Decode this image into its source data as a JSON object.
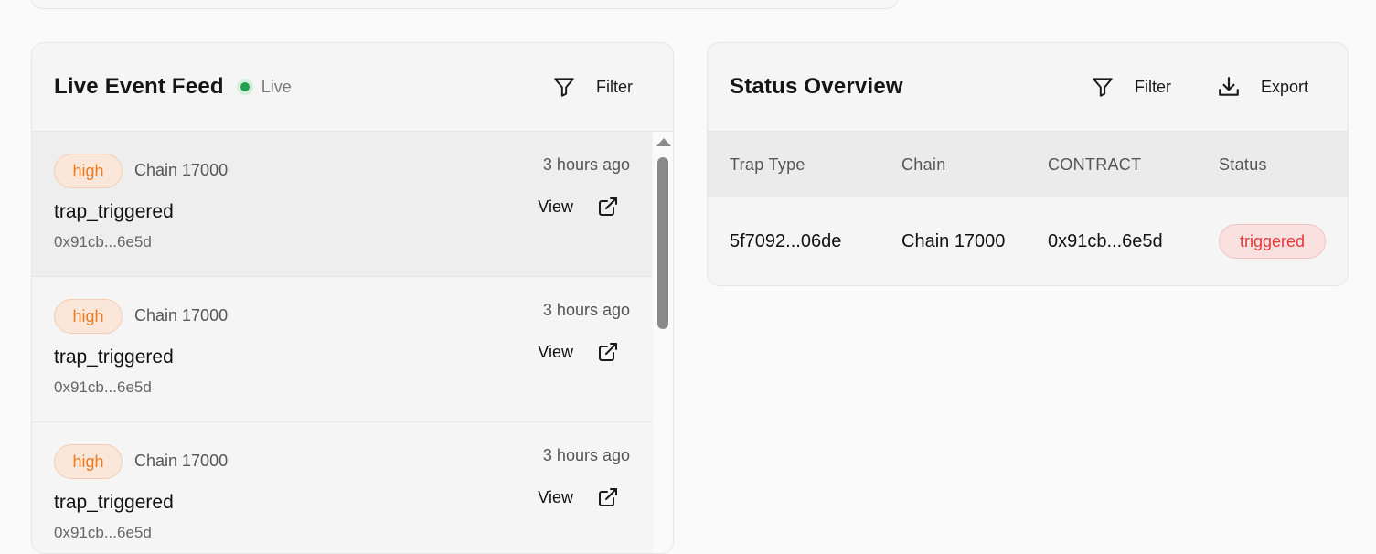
{
  "feed": {
    "title": "Live Event Feed",
    "live_label": "Live",
    "filter_label": "Filter",
    "items": [
      {
        "severity": "high",
        "chain": "Chain 17000",
        "time": "3 hours ago",
        "event": "trap_triggered",
        "address": "0x91cb...6e5d",
        "view_label": "View"
      },
      {
        "severity": "high",
        "chain": "Chain 17000",
        "time": "3 hours ago",
        "event": "trap_triggered",
        "address": "0x91cb...6e5d",
        "view_label": "View"
      },
      {
        "severity": "high",
        "chain": "Chain 17000",
        "time": "3 hours ago",
        "event": "trap_triggered",
        "address": "0x91cb...6e5d",
        "view_label": "View"
      }
    ]
  },
  "status": {
    "title": "Status Overview",
    "filter_label": "Filter",
    "export_label": "Export",
    "columns": [
      "Trap Type",
      "Chain",
      "CONTRACT",
      "Status"
    ],
    "rows": [
      {
        "trap_type": "5f7092...06de",
        "chain": "Chain 17000",
        "contract": "0x91cb...6e5d",
        "status": "triggered"
      }
    ]
  },
  "colors": {
    "severity_high": "#ee7a1f",
    "status_triggered": "#e03a3a",
    "live": "#22a04b"
  }
}
